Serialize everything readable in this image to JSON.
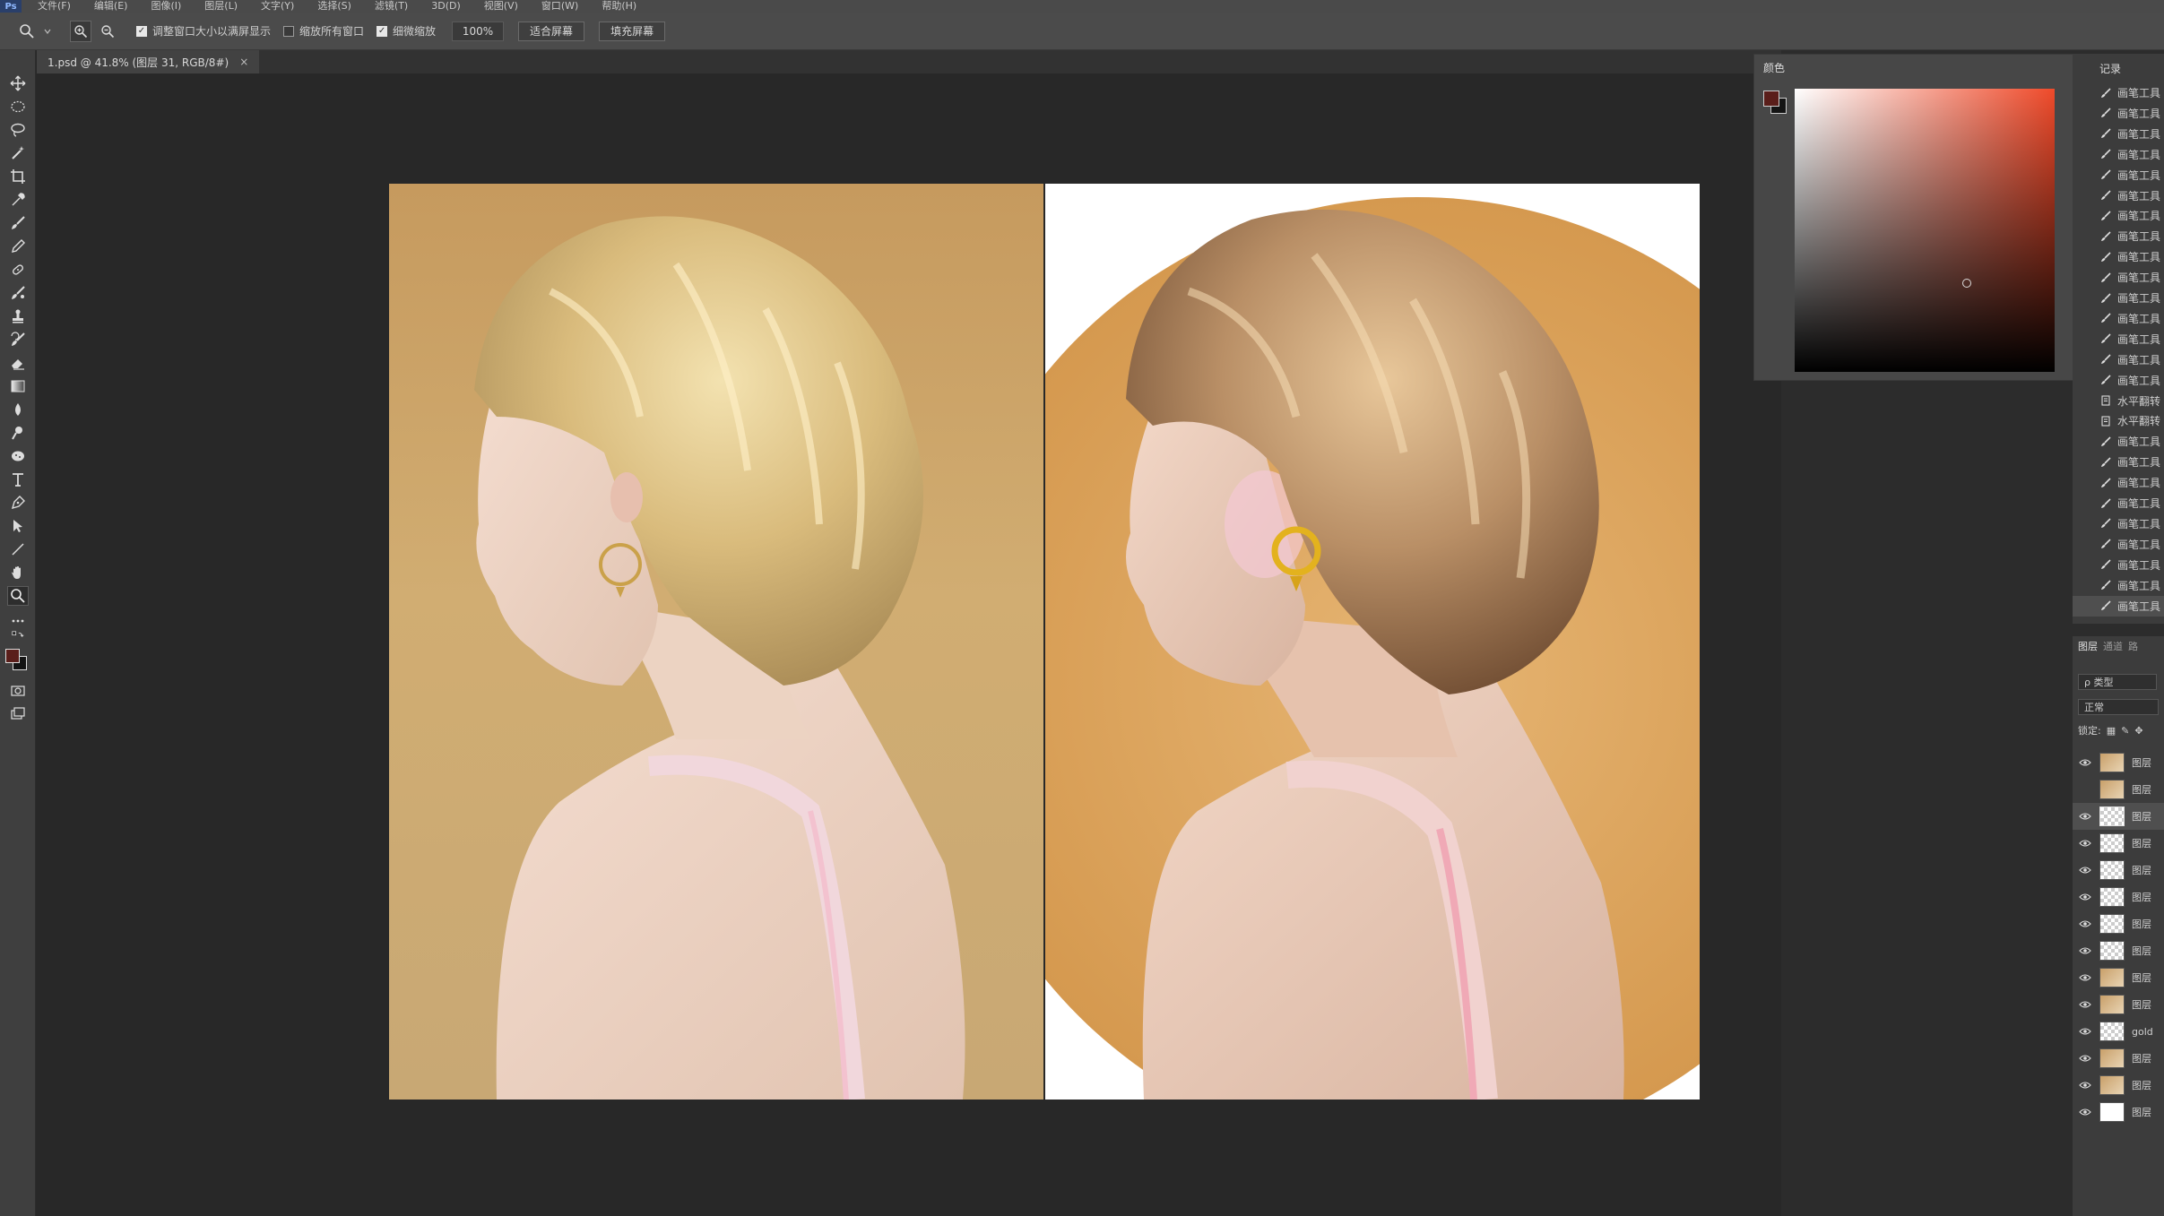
{
  "menubar": {
    "logo": "Ps",
    "items": [
      "文件(F)",
      "编辑(E)",
      "图像(I)",
      "图层(L)",
      "文字(Y)",
      "选择(S)",
      "滤镜(T)",
      "3D(D)",
      "视图(V)",
      "窗口(W)",
      "帮助(H)"
    ]
  },
  "options": {
    "check1_label": "调整窗口大小以满屏显示",
    "check2_label": "缩放所有窗口",
    "check3_label": "细微缩放",
    "zoom_value": "100%",
    "fit_screen": "适合屏幕",
    "fill_screen": "填充屏幕"
  },
  "document": {
    "tab_title": "1.psd @ 41.8% (图层 31, RGB/8#)",
    "close": "×"
  },
  "color_panel": {
    "title": "颜色",
    "foreground": "#5a1e1a",
    "background": "#141414",
    "hue": "#ef4a2a"
  },
  "history_panel": {
    "title": "记录",
    "items": [
      {
        "label": "画笔工具",
        "icon": "brush-icon"
      },
      {
        "label": "画笔工具",
        "icon": "brush-icon"
      },
      {
        "label": "画笔工具",
        "icon": "brush-icon"
      },
      {
        "label": "画笔工具",
        "icon": "brush-icon"
      },
      {
        "label": "画笔工具",
        "icon": "brush-icon"
      },
      {
        "label": "画笔工具",
        "icon": "brush-icon"
      },
      {
        "label": "画笔工具",
        "icon": "brush-icon"
      },
      {
        "label": "画笔工具",
        "icon": "brush-icon"
      },
      {
        "label": "画笔工具",
        "icon": "brush-icon"
      },
      {
        "label": "画笔工具",
        "icon": "brush-icon"
      },
      {
        "label": "画笔工具",
        "icon": "brush-icon"
      },
      {
        "label": "画笔工具",
        "icon": "brush-icon"
      },
      {
        "label": "画笔工具",
        "icon": "brush-icon"
      },
      {
        "label": "画笔工具",
        "icon": "brush-icon"
      },
      {
        "label": "画笔工具",
        "icon": "brush-icon"
      },
      {
        "label": "水平翻转",
        "icon": "document-icon"
      },
      {
        "label": "水平翻转",
        "icon": "document-icon"
      },
      {
        "label": "画笔工具",
        "icon": "brush-icon"
      },
      {
        "label": "画笔工具",
        "icon": "brush-icon"
      },
      {
        "label": "画笔工具",
        "icon": "brush-icon"
      },
      {
        "label": "画笔工具",
        "icon": "brush-icon"
      },
      {
        "label": "画笔工具",
        "icon": "brush-icon"
      },
      {
        "label": "画笔工具",
        "icon": "brush-icon"
      },
      {
        "label": "画笔工具",
        "icon": "brush-icon"
      },
      {
        "label": "画笔工具",
        "icon": "brush-icon"
      },
      {
        "label": "画笔工具",
        "icon": "brush-icon"
      }
    ]
  },
  "layers_panel": {
    "tabs": [
      "图层",
      "通道",
      "路"
    ],
    "filter": "ρ 类型",
    "blend_mode": "正常",
    "lock_label": "锁定:",
    "layers": [
      {
        "name": "图层",
        "visible": true,
        "thumb": "photo"
      },
      {
        "name": "图层",
        "visible": false,
        "thumb": "photo"
      },
      {
        "name": "图层",
        "visible": true,
        "thumb": "transparent",
        "selected": true
      },
      {
        "name": "图层",
        "visible": true,
        "thumb": "transparent"
      },
      {
        "name": "图层",
        "visible": true,
        "thumb": "transparent"
      },
      {
        "name": "图层",
        "visible": true,
        "thumb": "transparent"
      },
      {
        "name": "图层",
        "visible": true,
        "thumb": "transparent"
      },
      {
        "name": "图层",
        "visible": true,
        "thumb": "transparent"
      },
      {
        "name": "图层",
        "visible": true,
        "thumb": "photo"
      },
      {
        "name": "图层",
        "visible": true,
        "thumb": "photo"
      },
      {
        "name": "gold",
        "visible": true,
        "thumb": "transparent"
      },
      {
        "name": "图层",
        "visible": true,
        "thumb": "photo"
      },
      {
        "name": "图层",
        "visible": true,
        "thumb": "photo"
      },
      {
        "name": "图层",
        "visible": true,
        "thumb": "white"
      }
    ]
  }
}
